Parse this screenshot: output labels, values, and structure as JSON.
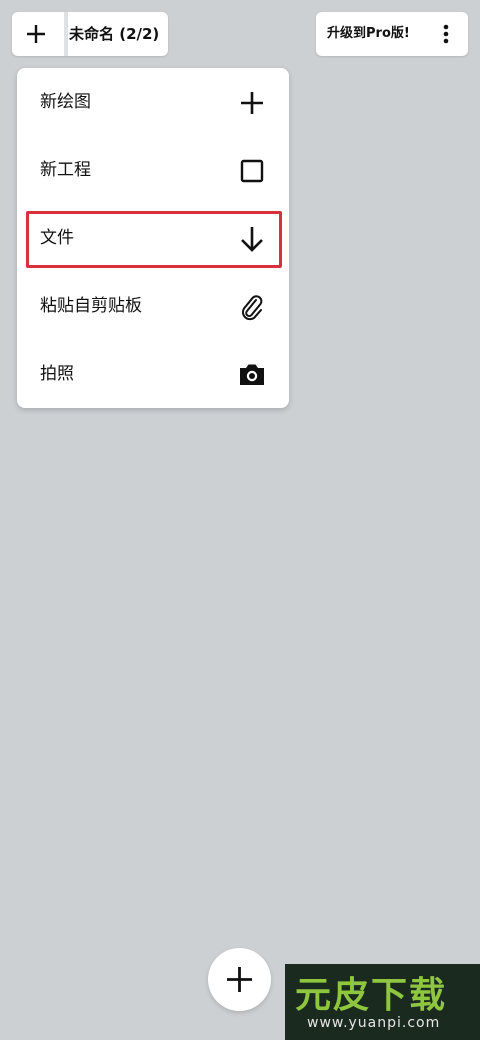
{
  "header": {
    "new_icon": "plus-icon",
    "title": "未命名 (2/2)",
    "upgrade_label": "升级到Pro版!",
    "more_icon": "more-vertical-icon"
  },
  "menu": {
    "items": [
      {
        "label": "新绘图",
        "icon": "plus-icon"
      },
      {
        "label": "新工程",
        "icon": "square-icon"
      },
      {
        "label": "文件",
        "icon": "arrow-down-icon",
        "highlighted": true
      },
      {
        "label": "粘贴自剪贴板",
        "icon": "paperclip-icon"
      },
      {
        "label": "拍照",
        "icon": "camera-icon"
      }
    ]
  },
  "fab": {
    "icon": "plus-icon"
  },
  "watermark": {
    "logo": "元皮下载",
    "url": "www.yuanpi.com"
  },
  "colors": {
    "canvas_background": "#ccd0d3",
    "highlight_border": "#d9303e",
    "watermark_background": "#1a2a1f",
    "watermark_logo": "#8ec63f"
  }
}
